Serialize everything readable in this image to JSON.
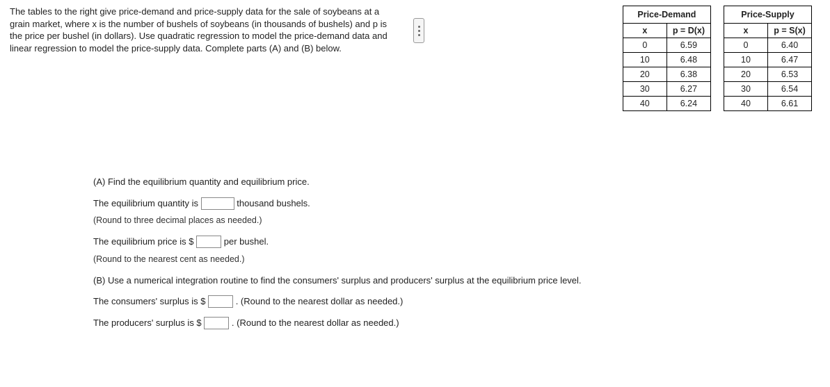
{
  "intro": "The tables to the right give price-demand and price-supply data for the sale of soybeans at a grain market, where x is the number of bushels of soybeans (in thousands of bushels) and p is the price per bushel (in dollars). Use quadratic regression to model the price-demand data and linear regression to model the price-supply data. Complete parts (A) and (B) below.",
  "demand": {
    "title": "Price-Demand",
    "xhead": "x",
    "phead": "p = D(x)",
    "rows": [
      {
        "x": "0",
        "p": "6.59"
      },
      {
        "x": "10",
        "p": "6.48"
      },
      {
        "x": "20",
        "p": "6.38"
      },
      {
        "x": "30",
        "p": "6.27"
      },
      {
        "x": "40",
        "p": "6.24"
      }
    ]
  },
  "supply": {
    "title": "Price-Supply",
    "xhead": "x",
    "phead": "p = S(x)",
    "rows": [
      {
        "x": "0",
        "p": "6.40"
      },
      {
        "x": "10",
        "p": "6.47"
      },
      {
        "x": "20",
        "p": "6.53"
      },
      {
        "x": "30",
        "p": "6.54"
      },
      {
        "x": "40",
        "p": "6.61"
      }
    ]
  },
  "q": {
    "a_head": "(A) Find the equilibrium quantity and equilibrium price.",
    "eq_qty_pre": "The equilibrium quantity is ",
    "eq_qty_post": " thousand bushels.",
    "eq_qty_hint": "(Round to three decimal places as needed.)",
    "eq_price_pre": "The equilibrium price is $",
    "eq_price_post": " per bushel.",
    "eq_price_hint": "(Round to the nearest cent as needed.)",
    "b_head": "(B) Use a numerical integration routine to find the consumers' surplus and producers' surplus at the equilibrium price level.",
    "cs_pre": "The consumers' surplus is $",
    "cs_post": ". (Round to the nearest dollar as needed.)",
    "ps_pre": "The producers' surplus is $",
    "ps_post": ". (Round to the nearest dollar as needed.)"
  }
}
